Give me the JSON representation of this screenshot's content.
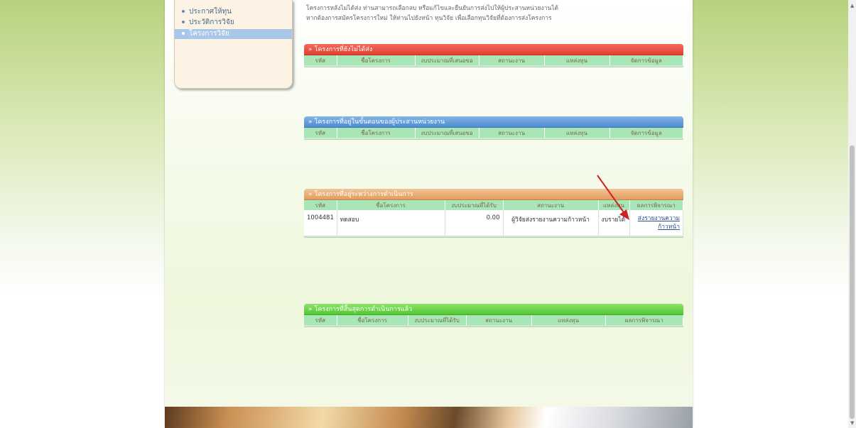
{
  "sidebar": {
    "items": [
      {
        "label": "ประกาศให้ทุน",
        "active": false
      },
      {
        "label": "ประวัติการวิจัย",
        "active": false
      },
      {
        "label": "โครงการวิจัย",
        "active": true
      }
    ]
  },
  "intro": {
    "line1": "โครงการหลังไม่ได้ส่ง ท่านสามารถเลือกลบ หรือแก้ไขและยืนยันการส่งไปให้ผู้ประสานหน่วยงานได้",
    "line2": "หากต้องการสมัครโครงการใหม่ ให้ท่านไปยังหน้า ทุนวิจัย เพื่อเลือกทุนวิจัยที่ต้องการส่งโครงการ"
  },
  "panels": {
    "not_sent": {
      "title": "โครงการที่ยังไม่ได้ส่ง",
      "columns": [
        "รหัส",
        "ชื่อโครงการ",
        "งบประมาณที่เสนอขอ",
        "สถานะงาน",
        "แหล่งทุน",
        "จัดการข้อมูล"
      ]
    },
    "coordinator": {
      "title": "โครงการที่อยู่ในขั้นตอนของผู้ประสานหน่วยงาน",
      "columns": [
        "รหัส",
        "ชื่อโครงการ",
        "งบประมาณที่เสนอขอ",
        "สถานะงาน",
        "แหล่งทุน",
        "จัดการข้อมูล"
      ]
    },
    "in_progress": {
      "title": "โครงการที่อยู่ระหว่างการดำเนินการ",
      "columns": [
        "รหัส",
        "ชื่อโครงการ",
        "งบประมาณที่ได้รับ",
        "สถานะงาน",
        "แหล่งทุน",
        "ผลการพิจารณา"
      ],
      "rows": [
        {
          "id": "1004481",
          "name": "ทดสอบ",
          "budget": "0.00",
          "status": "ผู้วิจัยส่งรายงานความก้าวหน้า",
          "source": "งบรายได้",
          "action_line1": "ส่งรายงานความ",
          "action_line2": "ก้าวหน้า"
        }
      ]
    },
    "completed": {
      "title": "โครงการที่สิ้นสุดการดำเนินการแล้ว",
      "columns": [
        "รหัส",
        "ชื่อโครงการ",
        "งบประมาณที่ได้รับ",
        "สถานะงาน",
        "แหล่งทุน",
        "ผลการพิจารณา"
      ]
    }
  },
  "header_arrow_glyph": "»",
  "colors": {
    "red_header": "#e03e2e",
    "blue_header": "#4a89cf",
    "orange_header": "#e0995a",
    "green_header": "#4fc52f",
    "column_header_bg": "#a8e6b8",
    "annotation_arrow": "#cc2222"
  }
}
